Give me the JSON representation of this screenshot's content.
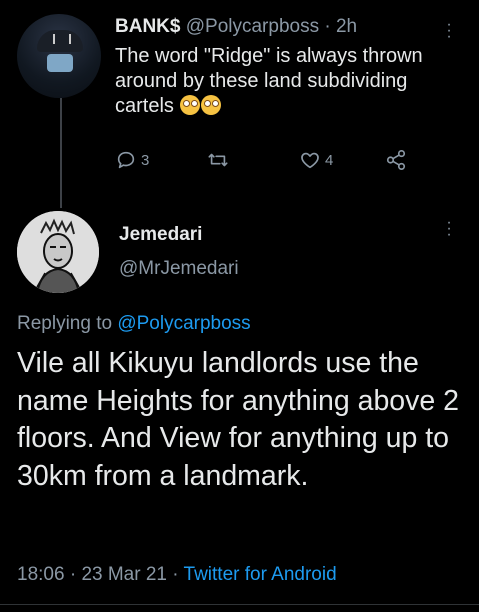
{
  "parent_tweet": {
    "display_name": "BANK$",
    "handle": "@Polycarpboss",
    "separator": "·",
    "time": "2h",
    "text": "The word \"Ridge\" is always thrown around by these land subdividing cartels",
    "emoji": [
      "face-with-rolling-eyes",
      "face-with-rolling-eyes"
    ],
    "reply_count": "3",
    "like_count": "4"
  },
  "main_tweet": {
    "display_name": "Jemedari",
    "handle": "@MrJemedari",
    "replying_prefix": "Replying to",
    "replying_to": "@Polycarpboss",
    "text": "Vile all Kikuyu landlords use the name Heights for anything above 2 floors. And View for anything up to 30km from a landmark.",
    "time": "18:06",
    "date": "23 Mar 21",
    "sep": "·",
    "source": "Twitter for Android"
  },
  "colors": {
    "background": "#000000",
    "text": "#e7e9ea",
    "muted": "#8b98a5",
    "link": "#1d9bf0"
  },
  "icons": [
    "reply-icon",
    "retweet-icon",
    "like-icon",
    "share-icon",
    "more-icon"
  ]
}
